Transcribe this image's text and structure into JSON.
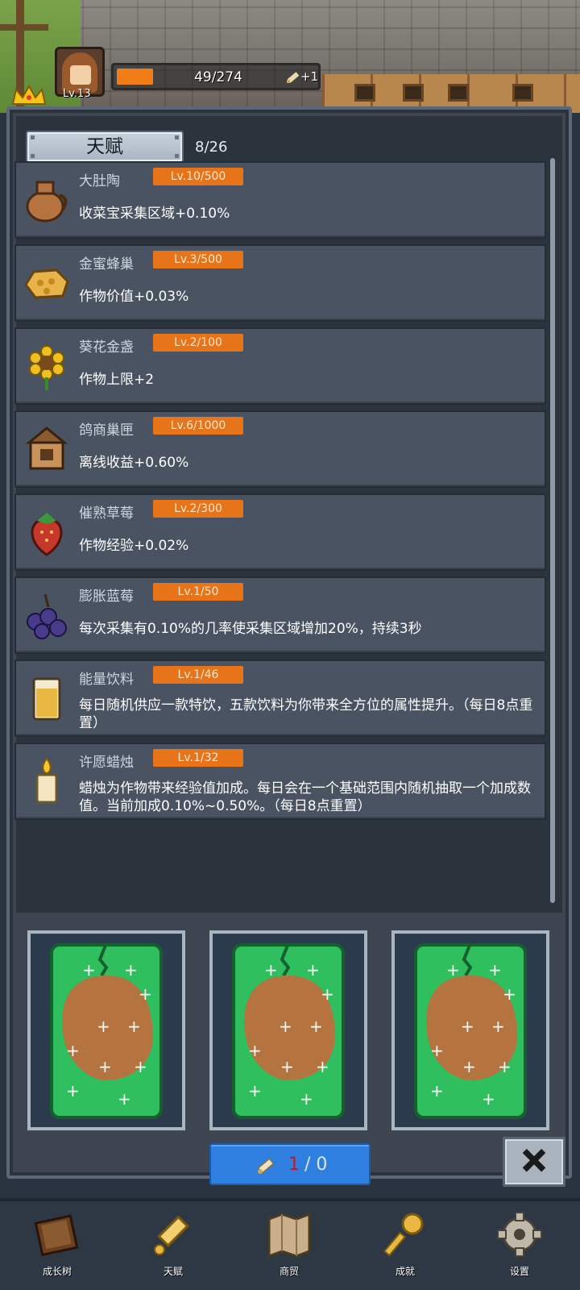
{
  "hud": {
    "level": "Lv.13",
    "progress": "49/274",
    "progress_fraction": 0.18,
    "bonus": "+1"
  },
  "panel": {
    "title": "天赋",
    "count": "8/26"
  },
  "talents": [
    {
      "name": "大肚陶",
      "level": "Lv.10/500",
      "desc": "收菜宝采集区域+0.10%",
      "icon": "jug-icon"
    },
    {
      "name": "金蜜蜂巢",
      "level": "Lv.3/500",
      "desc": "作物价值+0.03%",
      "icon": "honeycomb-icon"
    },
    {
      "name": "葵花金盏",
      "level": "Lv.2/100",
      "desc": "作物上限+2",
      "icon": "sunflower-icon"
    },
    {
      "name": "鸽商巢匣",
      "level": "Lv.6/1000",
      "desc": "离线收益+0.60%",
      "icon": "birdhouse-icon"
    },
    {
      "name": "催熟草莓",
      "level": "Lv.2/300",
      "desc": "作物经验+0.02%",
      "icon": "strawberry-icon"
    },
    {
      "name": "膨胀蓝莓",
      "level": "Lv.1/50",
      "desc": "每次采集有0.10%的几率使采集区域增加20%，持续3秒",
      "icon": "blueberry-icon"
    },
    {
      "name": "能量饮料",
      "level": "Lv.1/46",
      "desc": "每日随机供应一款特饮，五款饮料为你带来全方位的属性提升。（每日8点重置）",
      "icon": "drink-icon"
    },
    {
      "name": "许愿蜡烛",
      "level": "Lv.1/32",
      "desc": "蜡烛为作物带来经验值加成。每日会在一个基础范围内随机抽取一个加成数值。当前加成0.10%~0.50%。（每日8点重置）",
      "icon": "candle-icon"
    }
  ],
  "draw": {
    "current": "1",
    "rest": " / 0"
  },
  "nav": [
    {
      "label": "成长树",
      "icon": "book-icon"
    },
    {
      "label": "天赋",
      "icon": "scroll-icon"
    },
    {
      "label": "商贸",
      "icon": "map-icon"
    },
    {
      "label": "成就",
      "icon": "key-icon"
    },
    {
      "label": "设置",
      "icon": "gear-icon"
    }
  ],
  "colors": {
    "level_badge": "#e8741a",
    "draw_button": "#2f7fe0",
    "card_green": "#2fbf5f",
    "card_brown": "#b5733f"
  }
}
